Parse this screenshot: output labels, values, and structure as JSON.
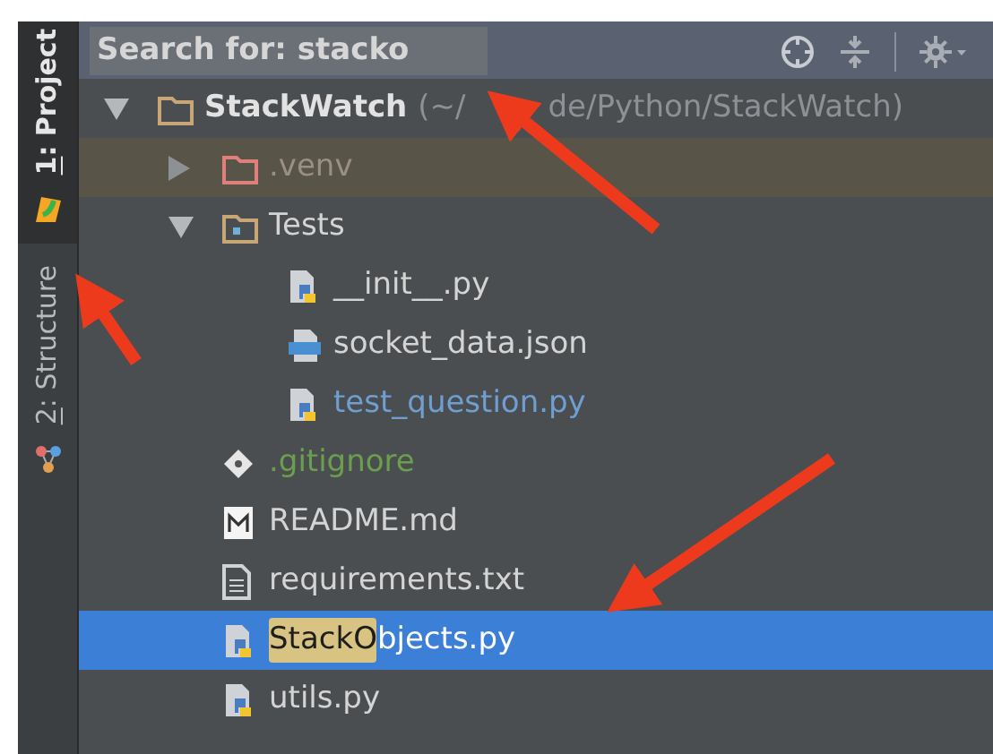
{
  "side_tabs": [
    {
      "number": "1",
      "label": ": Project",
      "kind": "project",
      "selected": true
    },
    {
      "number": "2",
      "label": ": Structure",
      "kind": "structure",
      "selected": false
    }
  ],
  "search": {
    "value": "Search for: stacko"
  },
  "tree": [
    {
      "kind": "folder",
      "name": "StackWatch",
      "path_parts": [
        "(~/",
        "de/Python/StackWatch)"
      ],
      "expanded": true,
      "selected": false,
      "children": [
        {
          "kind": "excluded-folder",
          "name": ".venv",
          "expanded": false,
          "selected": false,
          "color": "#9a8f84"
        },
        {
          "kind": "test-folder",
          "name": "Tests",
          "expanded": true,
          "selected": false,
          "children": [
            {
              "kind": "python",
              "name": "__init__.py",
              "selected": false
            },
            {
              "kind": "json",
              "name": "socket_data.json",
              "selected": false
            },
            {
              "kind": "python",
              "name": "test_question.py",
              "selected": false,
              "color": "#6f9fd0"
            }
          ]
        },
        {
          "kind": "git",
          "name": ".gitignore",
          "selected": false,
          "color": "#6a9f4e"
        },
        {
          "kind": "markdown",
          "name": "README.md",
          "selected": false
        },
        {
          "kind": "text",
          "name": "requirements.txt",
          "selected": false
        },
        {
          "kind": "python",
          "match": "StackO",
          "name": "bjects.py",
          "selected": true
        },
        {
          "kind": "python",
          "name": "utils.py",
          "selected": false
        }
      ]
    }
  ]
}
